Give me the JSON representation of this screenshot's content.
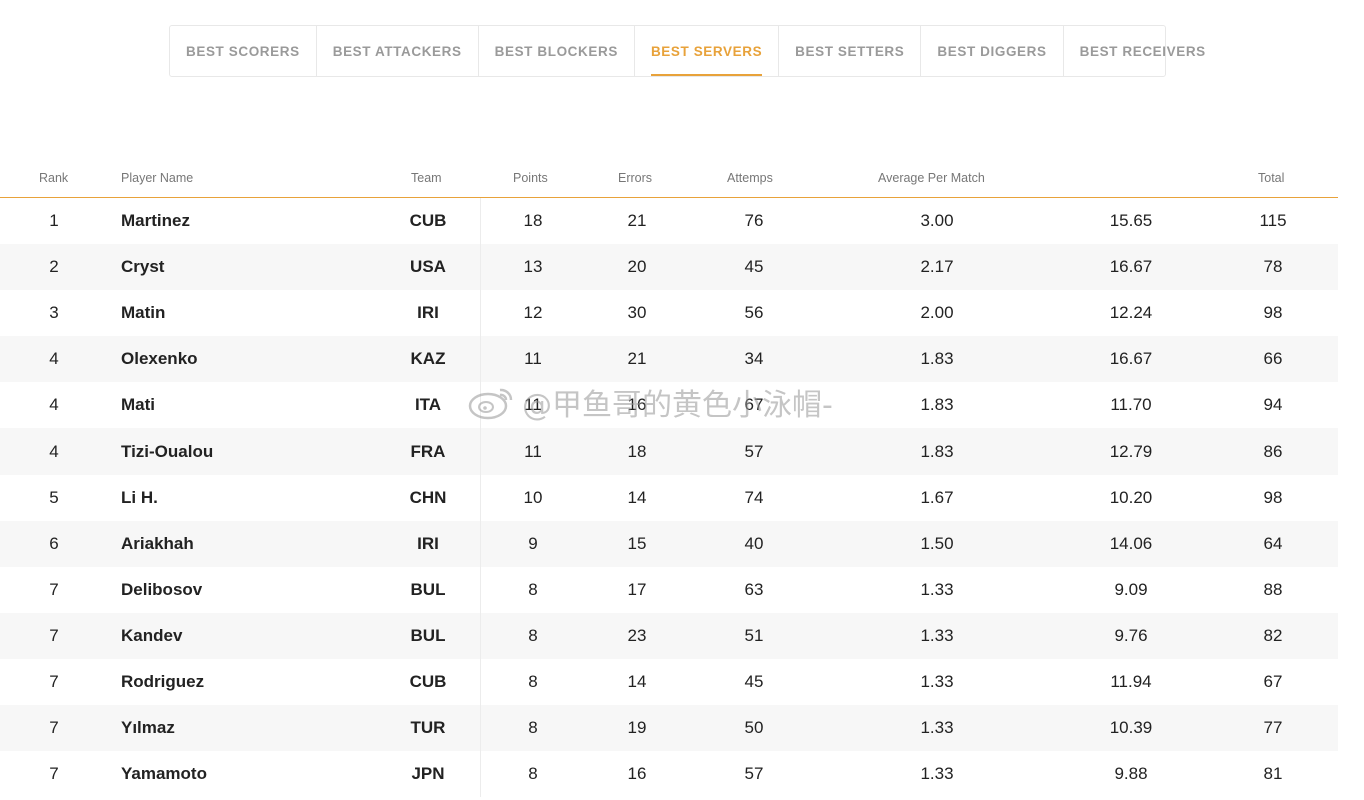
{
  "tabs": [
    {
      "label": "BEST SCORERS",
      "active": false
    },
    {
      "label": "BEST ATTACKERS",
      "active": false
    },
    {
      "label": "BEST BLOCKERS",
      "active": false
    },
    {
      "label": "BEST SERVERS",
      "active": true
    },
    {
      "label": "BEST SETTERS",
      "active": false
    },
    {
      "label": "BEST DIGGERS",
      "active": false
    },
    {
      "label": "BEST RECEIVERS",
      "active": false
    }
  ],
  "accent_color": "#e8a23a",
  "table": {
    "headers": {
      "rank": "Rank",
      "player": "Player Name",
      "team": "Team",
      "points": "Points",
      "errors": "Errors",
      "attempts": "Attemps",
      "avg": "Average Per Match",
      "col8": "",
      "total": "Total"
    },
    "rows": [
      {
        "rank": "1",
        "player": "Martinez",
        "team": "CUB",
        "points": "18",
        "errors": "21",
        "attempts": "76",
        "avg": "3.00",
        "col8": "15.65",
        "total": "115"
      },
      {
        "rank": "2",
        "player": "Cryst",
        "team": "USA",
        "points": "13",
        "errors": "20",
        "attempts": "45",
        "avg": "2.17",
        "col8": "16.67",
        "total": "78"
      },
      {
        "rank": "3",
        "player": "Matin",
        "team": "IRI",
        "points": "12",
        "errors": "30",
        "attempts": "56",
        "avg": "2.00",
        "col8": "12.24",
        "total": "98"
      },
      {
        "rank": "4",
        "player": "Olexenko",
        "team": "KAZ",
        "points": "11",
        "errors": "21",
        "attempts": "34",
        "avg": "1.83",
        "col8": "16.67",
        "total": "66"
      },
      {
        "rank": "4",
        "player": "Mati",
        "team": "ITA",
        "points": "11",
        "errors": "16",
        "attempts": "67",
        "avg": "1.83",
        "col8": "11.70",
        "total": "94"
      },
      {
        "rank": "4",
        "player": "Tizi-Oualou",
        "team": "FRA",
        "points": "11",
        "errors": "18",
        "attempts": "57",
        "avg": "1.83",
        "col8": "12.79",
        "total": "86"
      },
      {
        "rank": "5",
        "player": "Li H.",
        "team": "CHN",
        "points": "10",
        "errors": "14",
        "attempts": "74",
        "avg": "1.67",
        "col8": "10.20",
        "total": "98"
      },
      {
        "rank": "6",
        "player": "Ariakhah",
        "team": "IRI",
        "points": "9",
        "errors": "15",
        "attempts": "40",
        "avg": "1.50",
        "col8": "14.06",
        "total": "64"
      },
      {
        "rank": "7",
        "player": "Delibosov",
        "team": "BUL",
        "points": "8",
        "errors": "17",
        "attempts": "63",
        "avg": "1.33",
        "col8": "9.09",
        "total": "88"
      },
      {
        "rank": "7",
        "player": "Kandev",
        "team": "BUL",
        "points": "8",
        "errors": "23",
        "attempts": "51",
        "avg": "1.33",
        "col8": "9.76",
        "total": "82"
      },
      {
        "rank": "7",
        "player": "Rodriguez",
        "team": "CUB",
        "points": "8",
        "errors": "14",
        "attempts": "45",
        "avg": "1.33",
        "col8": "11.94",
        "total": "67"
      },
      {
        "rank": "7",
        "player": "Yılmaz",
        "team": "TUR",
        "points": "8",
        "errors": "19",
        "attempts": "50",
        "avg": "1.33",
        "col8": "10.39",
        "total": "77"
      },
      {
        "rank": "7",
        "player": "Yamamoto",
        "team": "JPN",
        "points": "8",
        "errors": "16",
        "attempts": "57",
        "avg": "1.33",
        "col8": "9.88",
        "total": "81"
      }
    ]
  },
  "watermark": {
    "text": "@甲鱼哥的黄色小泳帽-",
    "icon": "weibo-icon"
  }
}
